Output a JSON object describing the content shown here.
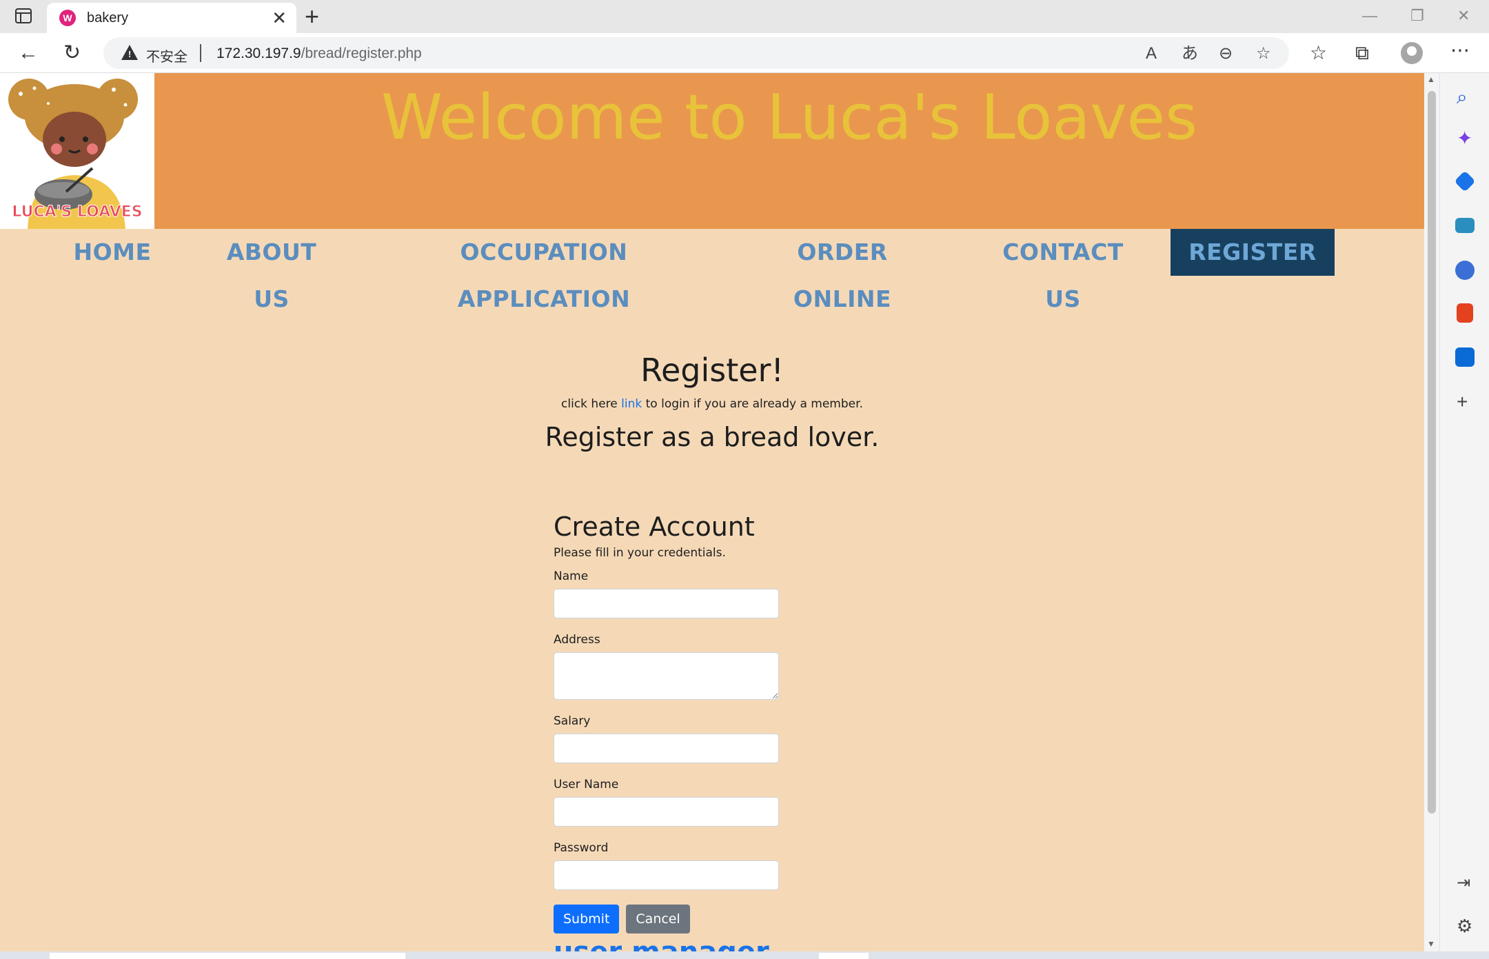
{
  "browser": {
    "tab_title": "bakery",
    "tab_favicon_letter": "W",
    "insecure_label": "不安全",
    "url_host": "172.30.197.9",
    "url_path": "/bread/register.php"
  },
  "site": {
    "welcome_title": "Welcome to Luca's Loaves",
    "logo_text": "LUCA'S LOAVES",
    "nav": [
      {
        "label": "HOME"
      },
      {
        "label": "ABOUT US"
      },
      {
        "label": "OCCUPATION APPLICATION"
      },
      {
        "label": "ORDER ONLINE"
      },
      {
        "label": "CONTACT US"
      },
      {
        "label": "REGISTER",
        "active": true
      }
    ],
    "colors": {
      "banner": "#e9974e",
      "page_bg": "#f5d9b7",
      "welcome_text": "#e8c33a",
      "nav_text": "#5b8dbe",
      "nav_active_bg": "#17405f"
    }
  },
  "register": {
    "title": "Register!",
    "sub_prefix": "click here ",
    "sub_link": "link",
    "sub_suffix": " to login if you are already a member.",
    "lover_heading": "Register as a bread lover."
  },
  "form": {
    "title": "Create Account",
    "help": "Please fill in your credentials.",
    "fields": {
      "name_label": "Name",
      "address_label": "Address",
      "salary_label": "Salary",
      "username_label": "User Name",
      "password_label": "Password"
    },
    "submit_label": "Submit",
    "cancel_label": "Cancel",
    "cutoff_text": "user manager"
  }
}
